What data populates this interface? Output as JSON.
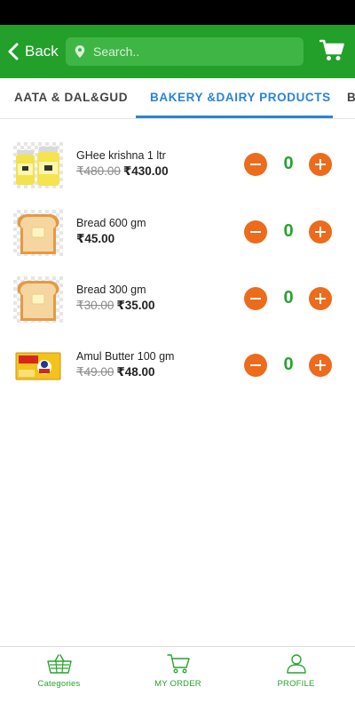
{
  "colors": {
    "primary_green": "#22a02a",
    "accent_blue": "#2a84d6",
    "qty_orange": "#ec6b1c",
    "qty_green": "#27a32f"
  },
  "header": {
    "back_label": "Back",
    "search_placeholder": "Search..",
    "cart_icon": "cart-icon"
  },
  "tabs": [
    {
      "label": "AATA & DAL&GUD",
      "active": false
    },
    {
      "label": "BAKERY &DAIRY PRODUCTS",
      "active": true
    },
    {
      "label": "B",
      "active": false
    }
  ],
  "products": [
    {
      "name": "GHee krishna 1 ltr",
      "old_price": "₹480.00",
      "price": "₹430.00",
      "qty": "0",
      "image": "ghee-jar"
    },
    {
      "name": "Bread 600 gm",
      "old_price": "",
      "price": "₹45.00",
      "qty": "0",
      "image": "bread-slice"
    },
    {
      "name": "Bread 300 gm",
      "old_price": "₹30.00",
      "price": "₹35.00",
      "qty": "0",
      "image": "bread-slice"
    },
    {
      "name": "Amul Butter 100 gm",
      "old_price": "₹49.00",
      "price": "₹48.00",
      "qty": "0",
      "image": "amul-butter"
    }
  ],
  "bottom_nav": [
    {
      "label": "Categories",
      "icon": "basket-icon"
    },
    {
      "label": "MY ORDER",
      "icon": "cart-icon"
    },
    {
      "label": "PROFILE",
      "icon": "person-icon"
    }
  ]
}
